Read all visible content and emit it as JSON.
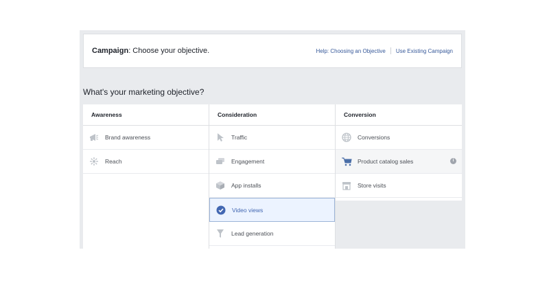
{
  "header": {
    "title_bold": "Campaign",
    "title_rest": ": Choose your objective.",
    "help_link": "Help: Choosing an Objective",
    "existing_link": "Use Existing Campaign"
  },
  "question": "What's your marketing objective?",
  "columns": {
    "awareness": {
      "heading": "Awareness",
      "items": [
        {
          "label": "Brand awareness",
          "icon": "megaphone-icon"
        },
        {
          "label": "Reach",
          "icon": "reach-icon"
        }
      ]
    },
    "consideration": {
      "heading": "Consideration",
      "items": [
        {
          "label": "Traffic",
          "icon": "cursor-icon"
        },
        {
          "label": "Engagement",
          "icon": "speech-bubbles-icon"
        },
        {
          "label": "App installs",
          "icon": "box-icon"
        },
        {
          "label": "Video views",
          "icon": "checkmark-circle-icon",
          "selected": true
        },
        {
          "label": "Lead generation",
          "icon": "funnel-icon"
        }
      ]
    },
    "conversion": {
      "heading": "Conversion",
      "items": [
        {
          "label": "Conversions",
          "icon": "globe-icon"
        },
        {
          "label": "Product catalog sales",
          "icon": "shopping-cart-icon"
        },
        {
          "label": "Store visits",
          "icon": "store-icon"
        }
      ]
    }
  },
  "info_glyph": "i",
  "colors": {
    "accent": "#4267b2",
    "selected_bg": "#ecf3ff",
    "icon_gray": "#bec3c9",
    "link": "#365899",
    "frame_bg": "#e9ebee"
  }
}
